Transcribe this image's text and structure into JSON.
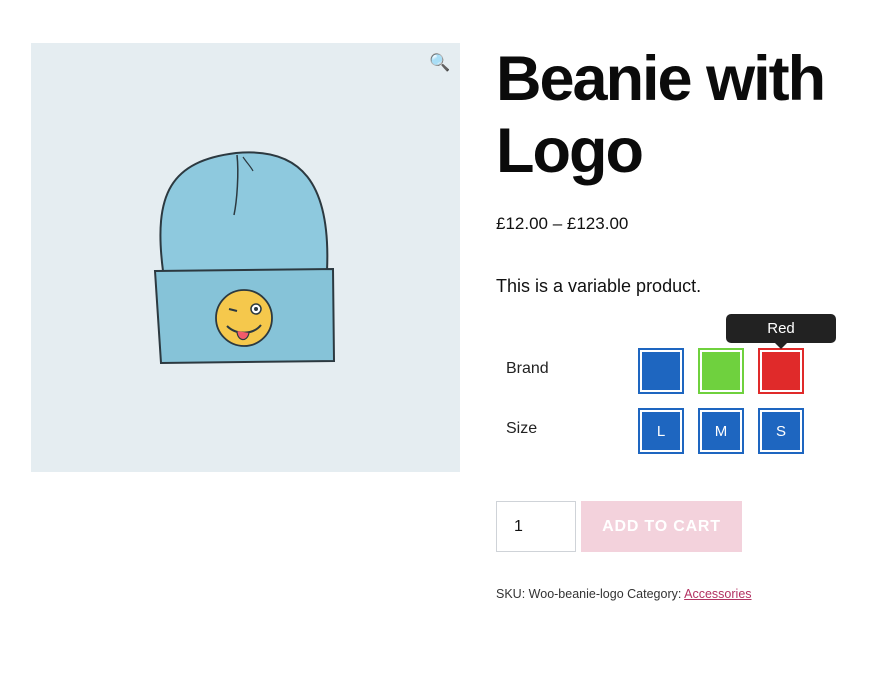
{
  "product": {
    "title": "Beanie with Logo",
    "price_range": "£12.00 – £123.00",
    "description": "This is a variable product.",
    "zoom_icon": "🔍",
    "image_alt": "Beanie with Logo"
  },
  "variations": {
    "brand_label": "Brand",
    "size_label": "Size",
    "tooltip": "Red",
    "brand_swatches": [
      {
        "name": "Blue",
        "color": "#1e66c0"
      },
      {
        "name": "Green",
        "color": "#6fd13e"
      },
      {
        "name": "Red",
        "color": "#e02a2a"
      }
    ],
    "size_swatches": [
      "L",
      "M",
      "S"
    ]
  },
  "cart": {
    "quantity": "1",
    "add_label": "ADD TO CART"
  },
  "meta": {
    "sku_label": "SKU:",
    "sku_value": "Woo-beanie-logo",
    "category_label": "Category:",
    "category_value": "Accessories"
  },
  "colors": {
    "accent": "#b23262",
    "button_disabled": "#f3d2dc",
    "swatch_blue": "#1e66c0"
  }
}
